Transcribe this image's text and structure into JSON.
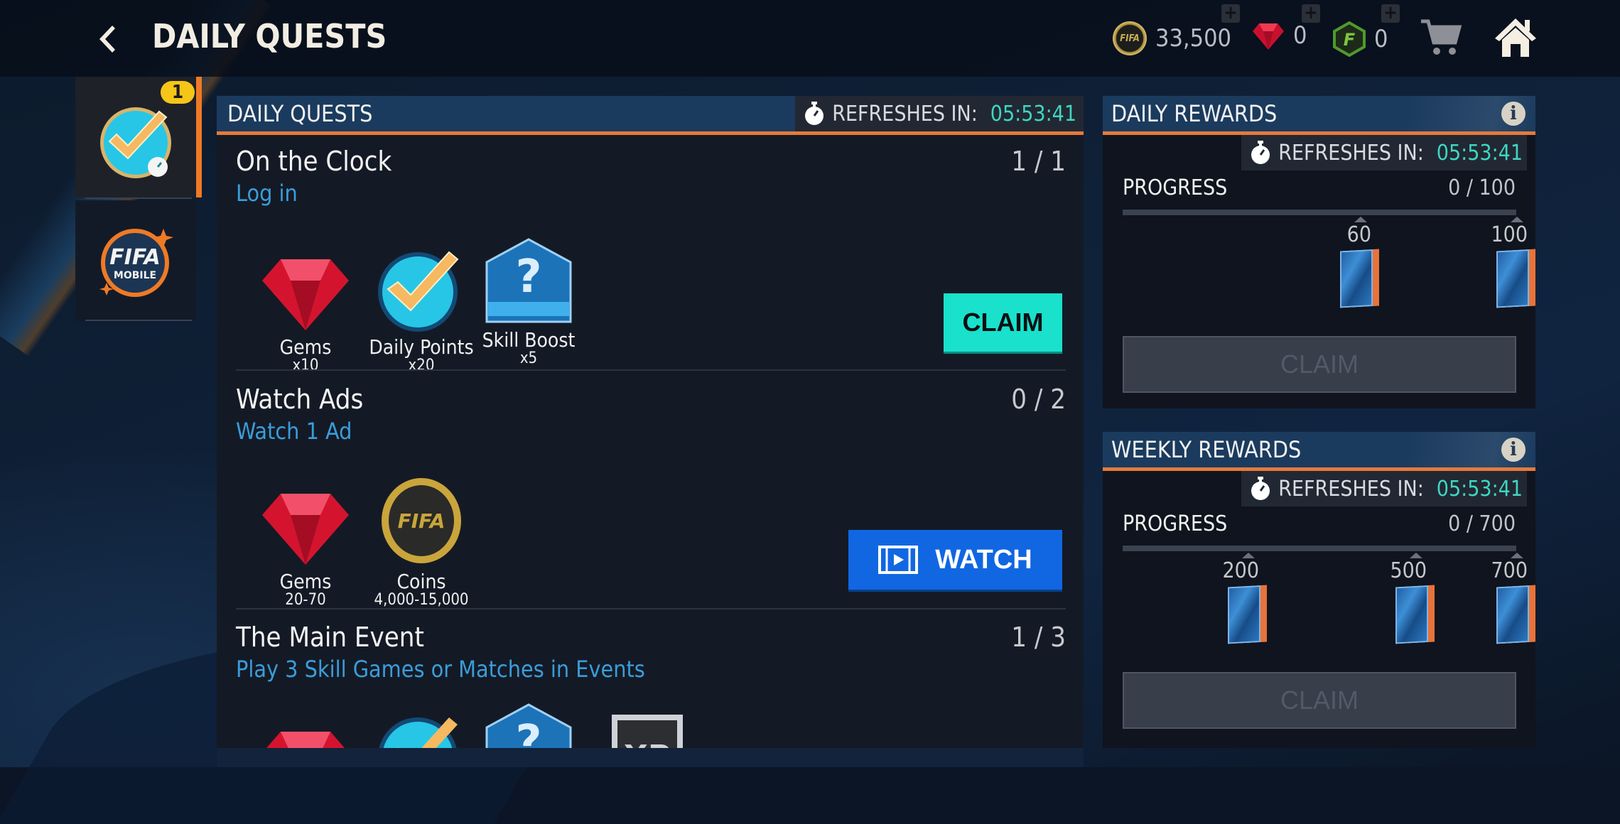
{
  "header": {
    "title": "DAILY QUESTS",
    "coins": "33,500",
    "coin_icon_text": "FIFA",
    "gems": "0",
    "fifa_points": "0",
    "fifa_points_icon_text": "F",
    "plus_label": "+"
  },
  "side_tabs": [
    {
      "name": "daily-quests",
      "badge": "1",
      "selected": true
    },
    {
      "name": "fifa-mobile",
      "icon_text_1": "FIFA",
      "icon_text_2": "MOBILE",
      "selected": false
    }
  ],
  "main": {
    "title": "DAILY QUESTS",
    "refresh_label": "REFRESHES IN:",
    "refresh_time": "05:53:41",
    "quests": [
      {
        "name": "On the Clock",
        "description": "Log in",
        "progress": "1 / 1",
        "rewards": [
          {
            "label": "Gems",
            "amount": "x10",
            "icon": "gem-icon"
          },
          {
            "label": "Daily Points",
            "amount": "x20",
            "icon": "checkmark-badge-icon"
          },
          {
            "label": "Skill Boost",
            "amount": "x5",
            "icon": "mystery-boost-icon"
          }
        ],
        "action": "CLAIM"
      },
      {
        "name": "Watch Ads",
        "description": "Watch 1 Ad",
        "progress": "0 / 2",
        "rewards": [
          {
            "label": "Gems",
            "amount": "20-70",
            "icon": "gem-icon"
          },
          {
            "label": "Coins",
            "amount": "4,000-15,000",
            "icon": "coin-icon",
            "icon_text": "FIFA"
          }
        ],
        "action": "WATCH"
      },
      {
        "name": "The Main Event",
        "description": "Play 3 Skill Games or Matches in Events",
        "progress": "1 / 3",
        "rewards": [
          {
            "icon": "gem-icon"
          },
          {
            "icon": "checkmark-badge-icon"
          },
          {
            "icon": "mystery-boost-icon"
          },
          {
            "icon": "xp-icon",
            "icon_text": "XP"
          }
        ]
      }
    ]
  },
  "daily_rewards": {
    "title": "DAILY REWARDS",
    "refresh_label": "REFRESHES IN:",
    "refresh_time": "05:53:41",
    "progress_label": "PROGRESS",
    "progress_value": "0 / 100",
    "progress_current": 0,
    "progress_max": 100,
    "milestones": [
      "60",
      "100"
    ],
    "claim_label": "CLAIM"
  },
  "weekly_rewards": {
    "title": "WEEKLY REWARDS",
    "refresh_label": "REFRESHES IN:",
    "refresh_time": "05:53:41",
    "progress_label": "PROGRESS",
    "progress_value": "0 / 700",
    "progress_current": 0,
    "progress_max": 700,
    "milestones": [
      "200",
      "500",
      "700"
    ],
    "claim_label": "CLAIM"
  },
  "colors": {
    "accent_orange": "#e57a3c",
    "timer_teal": "#3fd6c1",
    "claim_teal": "#19e1cc",
    "watch_blue": "#1167e2",
    "quest_desc_blue": "#3a9ddb",
    "badge_yellow": "#f5c518"
  }
}
